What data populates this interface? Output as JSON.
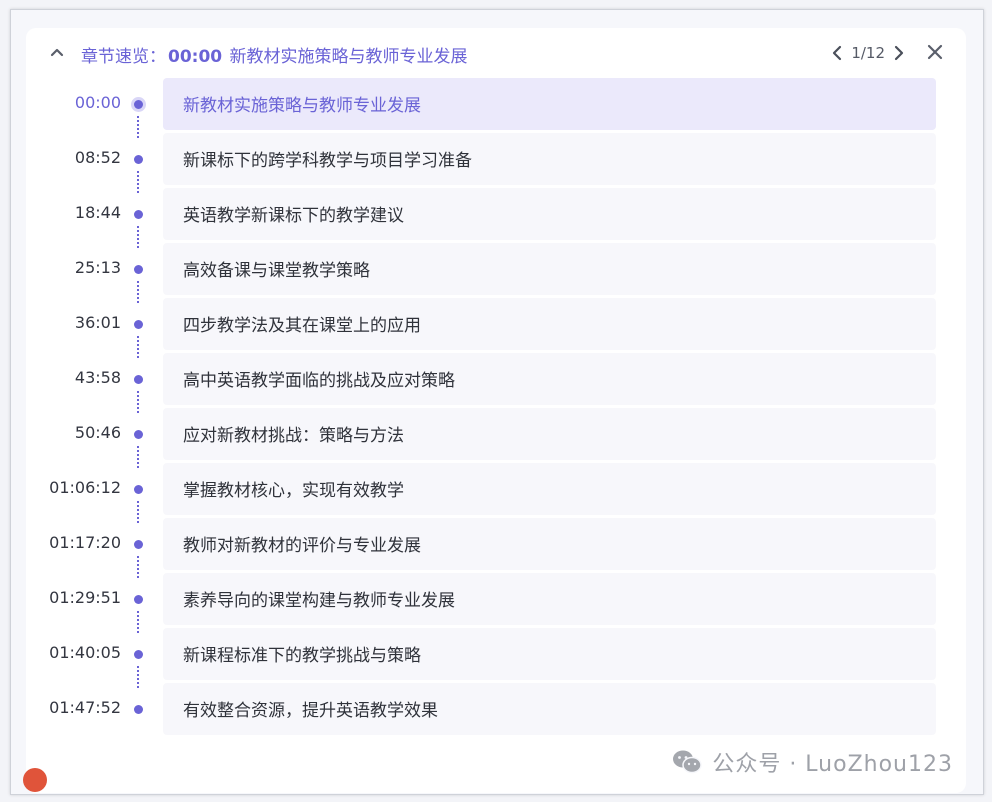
{
  "header": {
    "prefix": "章节速览：",
    "current_time": "00:00",
    "current_title": "新教材实施策略与教师专业发展",
    "page_current": "1",
    "page_total": "/12"
  },
  "icons": {
    "collapse": "chevron-up-icon",
    "prev": "chevron-left-icon",
    "next": "chevron-right-icon",
    "close": "close-icon",
    "watermark": "wechat-icon"
  },
  "colors": {
    "accent": "#6a63d6",
    "active_bg": "#ebe9fb",
    "item_bg": "#f7f7fb"
  },
  "chapters": [
    {
      "time": "00:00",
      "title": "新教材实施策略与教师专业发展",
      "active": true
    },
    {
      "time": "08:52",
      "title": "新课标下的跨学科教学与项目学习准备"
    },
    {
      "time": "18:44",
      "title": "英语教学新课标下的教学建议"
    },
    {
      "time": "25:13",
      "title": "高效备课与课堂教学策略"
    },
    {
      "time": "36:01",
      "title": "四步教学法及其在课堂上的应用"
    },
    {
      "time": "43:58",
      "title": "高中英语教学面临的挑战及应对策略"
    },
    {
      "time": "50:46",
      "title": "应对新教材挑战：策略与方法"
    },
    {
      "time": "01:06:12",
      "title": "掌握教材核心，实现有效教学"
    },
    {
      "time": "01:17:20",
      "title": "教师对新教材的评价与专业发展"
    },
    {
      "time": "01:29:51",
      "title": "素养导向的课堂构建与教师专业发展"
    },
    {
      "time": "01:40:05",
      "title": "新课程标准下的教学挑战与策略"
    },
    {
      "time": "01:47:52",
      "title": "有效整合资源，提升英语教学效果"
    }
  ],
  "watermark": {
    "text": "公众号 · LuoZhou123"
  }
}
